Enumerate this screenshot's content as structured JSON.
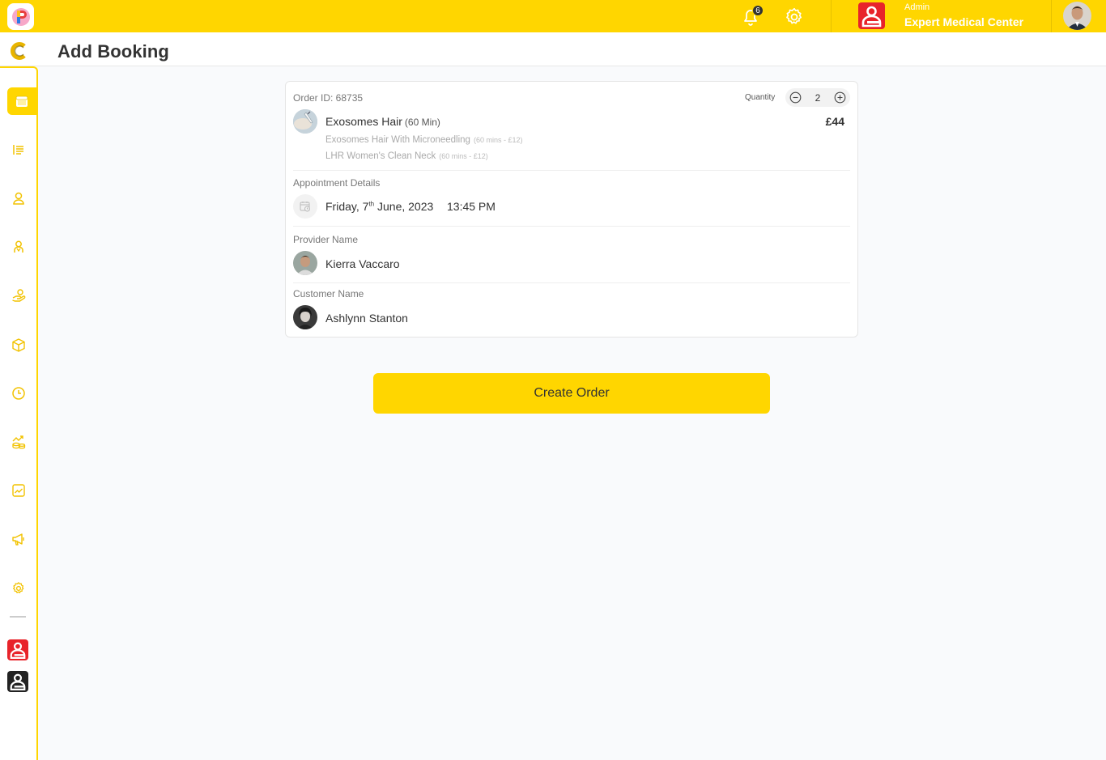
{
  "topbar": {
    "notification_count": "6",
    "org_role": "Admin",
    "org_name": "Expert Medical Center"
  },
  "header": {
    "page_title": "Add Booking"
  },
  "sidebar": {
    "items": [
      {
        "icon": "calendar-icon",
        "active": true
      },
      {
        "icon": "list-icon"
      },
      {
        "icon": "user-icon"
      },
      {
        "icon": "staff-icon"
      },
      {
        "icon": "hand-coins-icon"
      },
      {
        "icon": "box-icon"
      },
      {
        "icon": "clock-icon"
      },
      {
        "icon": "growth-coins-icon"
      },
      {
        "icon": "chart-icon"
      },
      {
        "icon": "megaphone-icon"
      },
      {
        "icon": "gear-icon"
      }
    ],
    "orgs": [
      {
        "icon": "org-logo-red",
        "color": "#e8232a"
      },
      {
        "icon": "org-logo-black",
        "color": "#222222"
      }
    ]
  },
  "order": {
    "order_id": "Order ID: 68735",
    "quantity_label": "Quantity",
    "quantity": "2",
    "service_name": "Exosomes Hair",
    "service_duration": "(60 Min)",
    "price": "£44",
    "addons": [
      {
        "name": "Exosomes Hair With Microneedling",
        "meta": "(60 mins - £12)"
      },
      {
        "name": "LHR Women's Clean Neck",
        "meta": "(60 mins - £12)"
      }
    ]
  },
  "appointment": {
    "label": "Appointment Details",
    "date_prefix": "Friday, 7",
    "date_sup": "th",
    "date_suffix": " June, 2023",
    "time": "13:45 PM"
  },
  "provider": {
    "label": "Provider Name",
    "name": "Kierra Vaccaro"
  },
  "customer": {
    "label": "Customer Name",
    "name": "Ashlynn Stanton"
  },
  "actions": {
    "create_label": "Create Order"
  },
  "colors": {
    "accent": "#ffd600",
    "brand_red": "#e8232a"
  }
}
